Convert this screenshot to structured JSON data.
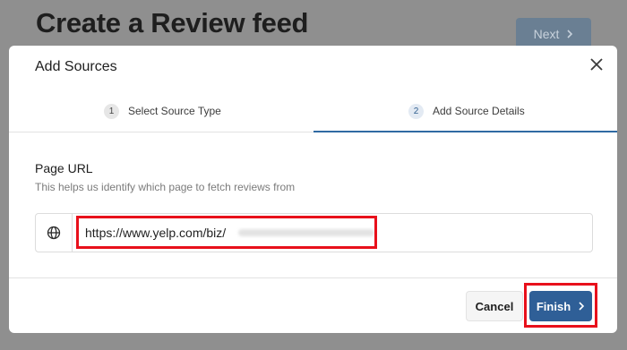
{
  "background": {
    "title": "Create a Review feed",
    "next_label": "Next"
  },
  "modal": {
    "title": "Add Sources",
    "steps": [
      {
        "number": "1",
        "label": "Select Source Type"
      },
      {
        "number": "2",
        "label": "Add Source Details"
      }
    ],
    "field": {
      "label": "Page URL",
      "help": "This helps us identify which page to fetch reviews from",
      "value": "https://www.yelp.com/biz/"
    },
    "cancel_label": "Cancel",
    "finish_label": "Finish"
  },
  "colors": {
    "accent": "#2f5f97",
    "highlight": "#e8101b",
    "active_underline": "#2f6aa3"
  },
  "icons": {
    "close": "close-icon",
    "globe": "globe-icon",
    "chevron": "chevron-right-icon"
  }
}
